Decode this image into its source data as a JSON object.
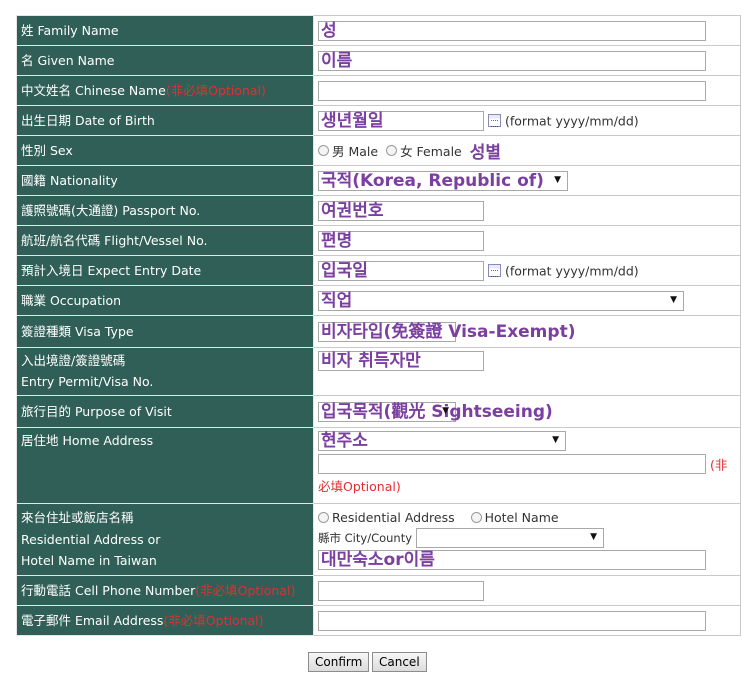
{
  "rows": {
    "family_name": {
      "label": "姓 Family Name",
      "value": "성"
    },
    "given_name": {
      "label": "名 Given Name",
      "value": "이름"
    },
    "chinese_name": {
      "label": "中文姓名 Chinese Name",
      "optional": "(非必填Optional)"
    },
    "dob": {
      "label": "出生日期 Date of Birth",
      "value": "생년월일",
      "format": "(format yyyy/mm/dd)"
    },
    "sex": {
      "label": "性別 Sex",
      "male": "男 Male",
      "female": "女 Female",
      "note": "성별"
    },
    "nationality": {
      "label": "國籍 Nationality",
      "value": "국적(Korea, Republic of)"
    },
    "passport": {
      "label": "護照號碼(大通證) Passport No.",
      "value": "여권번호"
    },
    "flight": {
      "label": "航班/航名代碼 Flight/Vessel No.",
      "value": "편명"
    },
    "entry_date": {
      "label": "預計入境日 Expect Entry Date",
      "value": "입국일",
      "format": "(format yyyy/mm/dd)"
    },
    "occupation": {
      "label": "職業 Occupation",
      "value": "직업"
    },
    "visa_type": {
      "label": "簽證種類 Visa Type",
      "value": "비자타입(免簽證 Visa-Exempt)"
    },
    "entry_permit": {
      "label1": "入出境證/簽證號碼",
      "label2": "Entry Permit/Visa No.",
      "value": "비자 취득자만"
    },
    "purpose": {
      "label": "旅行目的 Purpose of Visit",
      "value": "입국목적(觀光 Sightseeing)"
    },
    "home_address": {
      "label": "居住地 Home Address",
      "value": "현주소",
      "opt1": "(非",
      "opt2": "必填Optional)"
    },
    "residential": {
      "label1": "來台住址或飯店名稱",
      "label2": "Residential Address or",
      "label3": "Hotel Name in Taiwan",
      "opt_residential": "Residential Address",
      "opt_hotel": "Hotel Name",
      "city_label": "縣市 City/County",
      "value": "대만숙소or이름"
    },
    "cell": {
      "label": "行動電話 Cell Phone Number",
      "optional": "(非必填Optional)"
    },
    "email": {
      "label": "電子郵件 Email Address",
      "optional": "(非必填Optional)"
    }
  },
  "buttons": {
    "confirm": "Confirm",
    "cancel": "Cancel"
  }
}
